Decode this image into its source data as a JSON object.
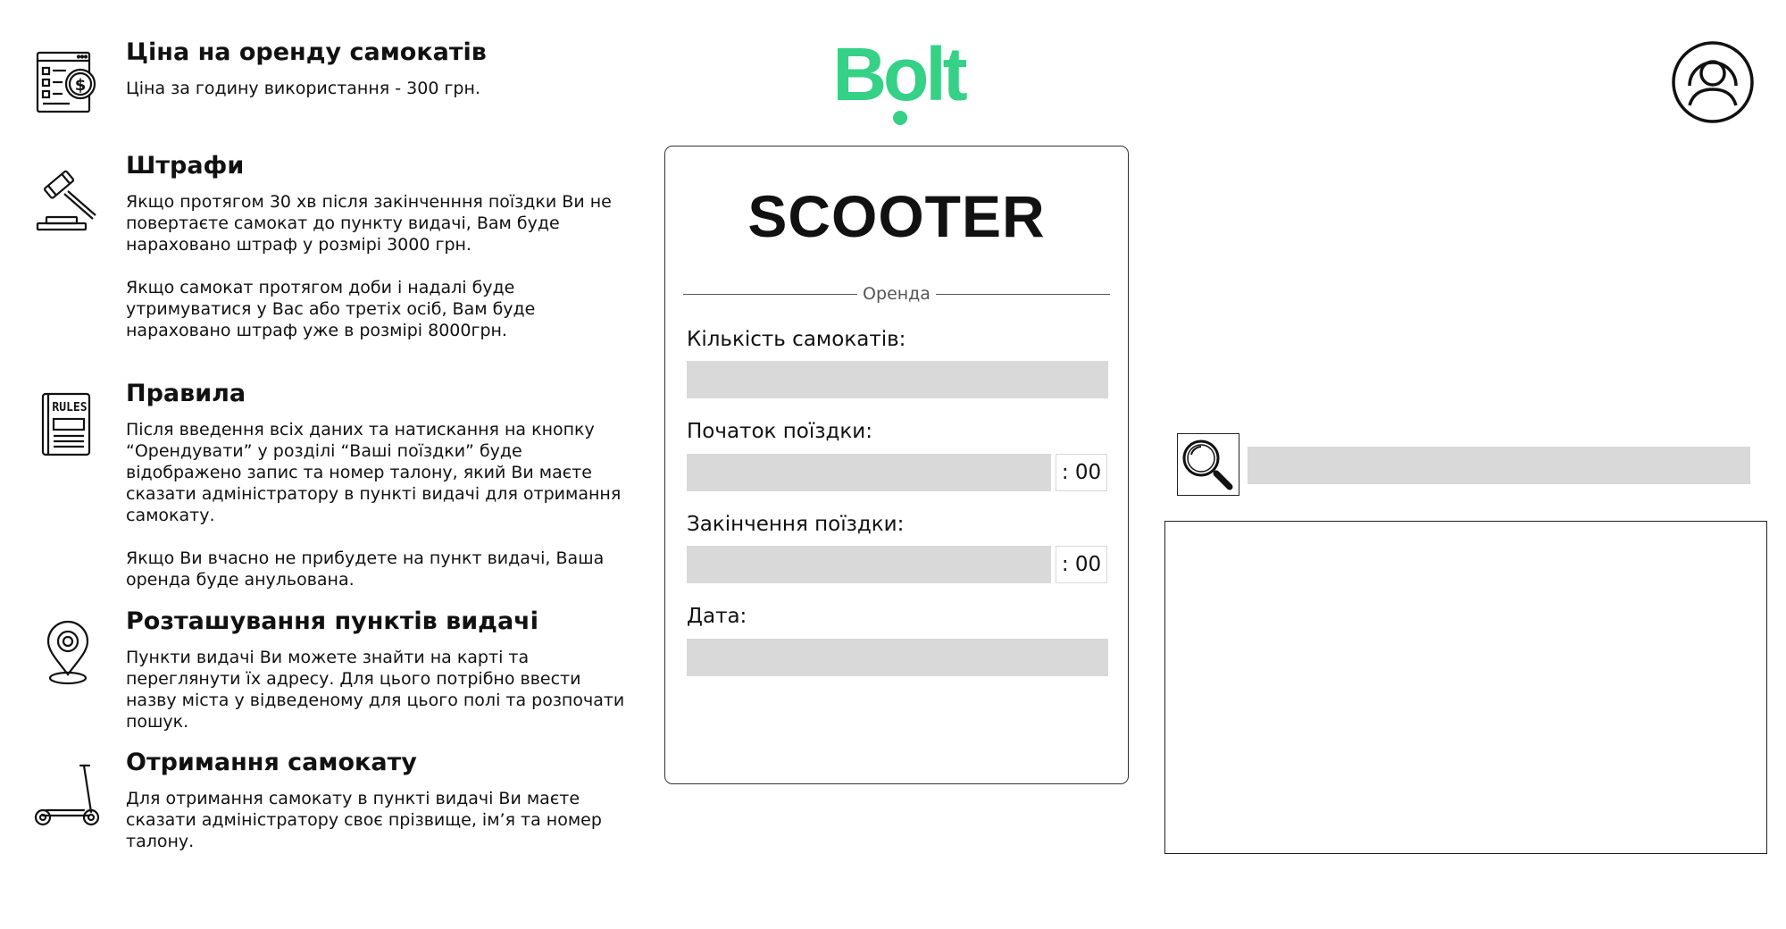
{
  "brand": {
    "logo_text": "Bolt",
    "color": "#34D186"
  },
  "info": [
    {
      "icon": "price-list-icon",
      "title": "Ціна на оренду самокатів",
      "paragraphs": [
        "Ціна за годину використання - 300 грн."
      ]
    },
    {
      "icon": "gavel-icon",
      "title": "Штрафи",
      "paragraphs": [
        "Якщо протягом 30 хв після закінченння поїздки Ви не повертаєте самокат до пункту видачі, Вам буде нараховано штраф у розмірі 3000 грн.",
        "Якщо самокат протягом доби і надалі буде утримуватися у Вас або третіх осіб, Вам буде нараховано штраф уже в розмірі 8000грн."
      ]
    },
    {
      "icon": "rules-book-icon",
      "title": "Правила",
      "icon_label": "RULES",
      "paragraphs": [
        "Після введення всіх даних та натискання на кнопку “Орендувати” у розділі “Ваші поїздки” буде відображено запис та номер талону, який Ви маєте сказати адміністратору в пункті видачі для отримання самокату.",
        "Якщо Ви вчасно не прибудете на пункт видачі, Ваша оренда буде анульована."
      ]
    },
    {
      "icon": "location-pin-icon",
      "title": "Розташування пунктів видачі",
      "paragraphs": [
        "Пункти видачі Ви можете знайти на карті та переглянути їх адресу. Для цього потрібно ввести назву міста у відведеному для цього полі та розпочати пошук."
      ]
    },
    {
      "icon": "scooter-icon",
      "title": "Отримання самокату",
      "paragraphs": [
        "Для отримання самокату в пункті видачі Ви маєте сказати адміністратору своє прізвище, ім’я та номер талону."
      ]
    }
  ],
  "rental_form": {
    "title": "SCOOTER",
    "section_label": "Оренда",
    "quantity_label": "Кількість самокатів:",
    "quantity_value": "",
    "start_label": "Початок поїздки:",
    "start_value": "",
    "start_suffix": ": 00",
    "end_label": "Закінчення поїздки:",
    "end_value": "",
    "end_suffix": ": 00",
    "date_label": "Дата:",
    "date_value": ""
  },
  "search": {
    "icon": "search-icon",
    "value": ""
  },
  "user": {
    "icon": "user-avatar-icon"
  }
}
